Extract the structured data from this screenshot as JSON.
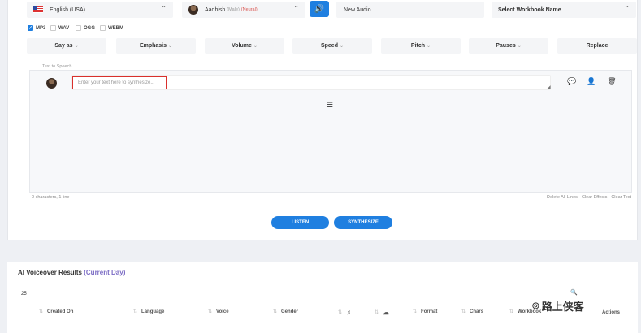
{
  "top": {
    "language": "English (USA)",
    "voice_name": "Aadhish",
    "voice_gender": "(Male)",
    "voice_type": "(Neural)",
    "project_name": "New Audio",
    "workbook": "Select Workbook Name"
  },
  "formats": [
    {
      "label": "MP3",
      "checked": true
    },
    {
      "label": "WAV",
      "checked": false
    },
    {
      "label": "OGG",
      "checked": false
    },
    {
      "label": "WEBM",
      "checked": false
    }
  ],
  "effects": [
    "Say as",
    "Emphasis",
    "Volume",
    "Speed",
    "Pitch",
    "Pauses",
    "Replace"
  ],
  "tts": {
    "legend": "Text to Speech",
    "placeholder": "Enter your text here to synthesize...",
    "status": "0 characters, 1 line",
    "links": [
      "Delete All Lines",
      "Clear Effects",
      "Clear Text"
    ]
  },
  "buttons": {
    "listen": "LISTEN",
    "synthesize": "SYNTHESIZE"
  },
  "results": {
    "title": "AI Voiceover Results",
    "subtitle": "(Current Day)",
    "page_size": "25",
    "columns": [
      "Created On",
      "Language",
      "Voice",
      "Gender",
      "Format",
      "Chars",
      "Workbook",
      "Actions"
    ]
  },
  "watermark": "路上侠客",
  "colors": {
    "accent": "#1f7fe0",
    "highlight": "#d9302c"
  }
}
